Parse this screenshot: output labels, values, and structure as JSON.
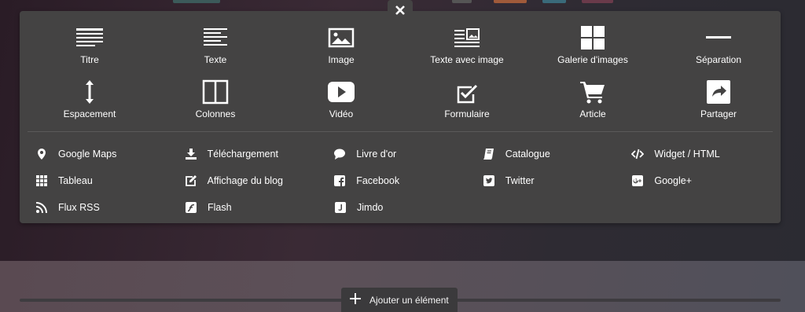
{
  "colors": {
    "panel_bg": "#444343",
    "text": "#ffffff"
  },
  "close_button": {
    "icon": "close-icon"
  },
  "add_element": {
    "label": "Ajouter un élément",
    "icon": "plus-icon"
  },
  "big_items": [
    {
      "label": "Titre",
      "icon": "title-icon"
    },
    {
      "label": "Texte",
      "icon": "text-icon"
    },
    {
      "label": "Image",
      "icon": "image-icon"
    },
    {
      "label": "Texte avec image",
      "icon": "text-with-image-icon"
    },
    {
      "label": "Galerie d'images",
      "icon": "gallery-icon"
    },
    {
      "label": "Séparation",
      "icon": "separator-icon"
    },
    {
      "label": "Espacement",
      "icon": "spacing-icon"
    },
    {
      "label": "Colonnes",
      "icon": "columns-icon"
    },
    {
      "label": "Vidéo",
      "icon": "video-icon"
    },
    {
      "label": "Formulaire",
      "icon": "form-icon"
    },
    {
      "label": "Article",
      "icon": "cart-icon"
    },
    {
      "label": "Partager",
      "icon": "share-icon"
    }
  ],
  "small_items": [
    {
      "label": "Google Maps",
      "icon": "map-pin-icon"
    },
    {
      "label": "Téléchargement",
      "icon": "download-icon"
    },
    {
      "label": "Livre d'or",
      "icon": "speech-bubble-icon"
    },
    {
      "label": "Catalogue",
      "icon": "book-icon"
    },
    {
      "label": "Widget / HTML",
      "icon": "code-icon"
    },
    {
      "label": "Tableau",
      "icon": "table-icon"
    },
    {
      "label": "Affichage du blog",
      "icon": "edit-icon"
    },
    {
      "label": "Facebook",
      "icon": "facebook-icon"
    },
    {
      "label": "Twitter",
      "icon": "twitter-icon"
    },
    {
      "label": "Google+",
      "icon": "google-plus-icon"
    },
    {
      "label": "Flux RSS",
      "icon": "rss-icon"
    },
    {
      "label": "Flash",
      "icon": "flash-icon"
    },
    {
      "label": "Jimdo",
      "icon": "jimdo-icon"
    }
  ]
}
